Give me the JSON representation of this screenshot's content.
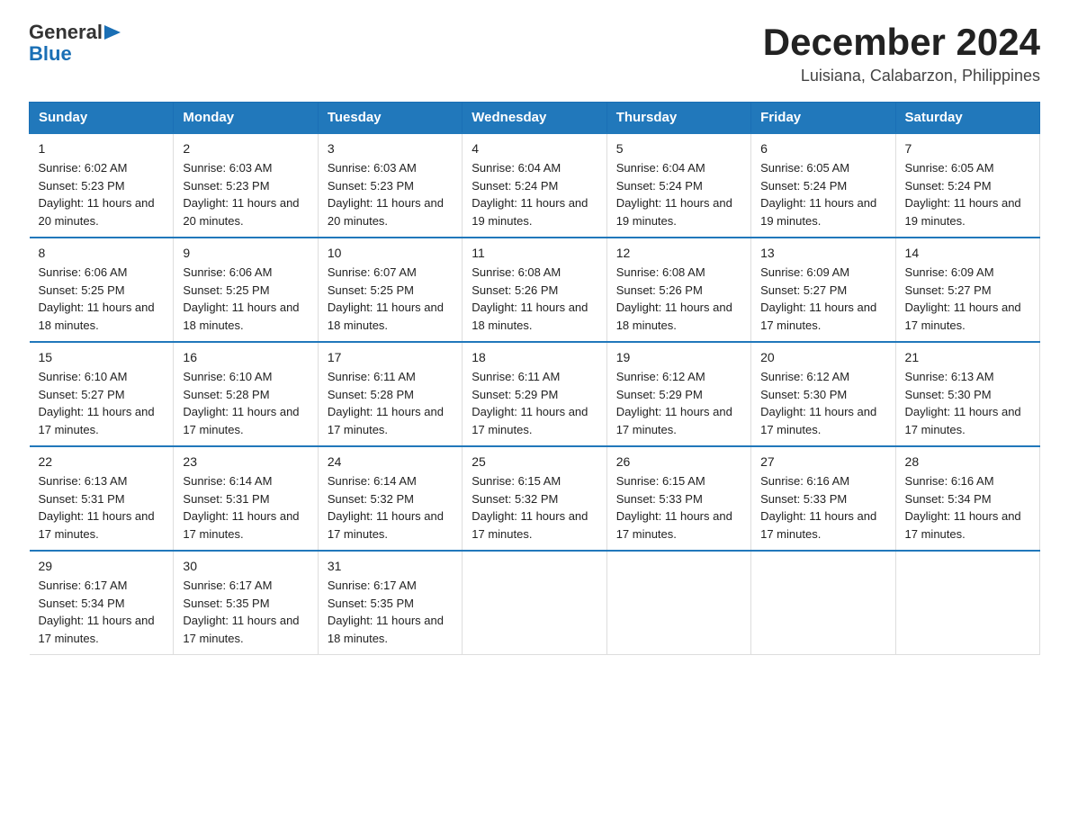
{
  "header": {
    "logo_general": "General",
    "logo_blue": "Blue",
    "main_title": "December 2024",
    "subtitle": "Luisiana, Calabarzon, Philippines"
  },
  "calendar": {
    "days_of_week": [
      "Sunday",
      "Monday",
      "Tuesday",
      "Wednesday",
      "Thursday",
      "Friday",
      "Saturday"
    ],
    "weeks": [
      [
        {
          "day": "1",
          "sunrise": "6:02 AM",
          "sunset": "5:23 PM",
          "daylight": "11 hours and 20 minutes."
        },
        {
          "day": "2",
          "sunrise": "6:03 AM",
          "sunset": "5:23 PM",
          "daylight": "11 hours and 20 minutes."
        },
        {
          "day": "3",
          "sunrise": "6:03 AM",
          "sunset": "5:23 PM",
          "daylight": "11 hours and 20 minutes."
        },
        {
          "day": "4",
          "sunrise": "6:04 AM",
          "sunset": "5:24 PM",
          "daylight": "11 hours and 19 minutes."
        },
        {
          "day": "5",
          "sunrise": "6:04 AM",
          "sunset": "5:24 PM",
          "daylight": "11 hours and 19 minutes."
        },
        {
          "day": "6",
          "sunrise": "6:05 AM",
          "sunset": "5:24 PM",
          "daylight": "11 hours and 19 minutes."
        },
        {
          "day": "7",
          "sunrise": "6:05 AM",
          "sunset": "5:24 PM",
          "daylight": "11 hours and 19 minutes."
        }
      ],
      [
        {
          "day": "8",
          "sunrise": "6:06 AM",
          "sunset": "5:25 PM",
          "daylight": "11 hours and 18 minutes."
        },
        {
          "day": "9",
          "sunrise": "6:06 AM",
          "sunset": "5:25 PM",
          "daylight": "11 hours and 18 minutes."
        },
        {
          "day": "10",
          "sunrise": "6:07 AM",
          "sunset": "5:25 PM",
          "daylight": "11 hours and 18 minutes."
        },
        {
          "day": "11",
          "sunrise": "6:08 AM",
          "sunset": "5:26 PM",
          "daylight": "11 hours and 18 minutes."
        },
        {
          "day": "12",
          "sunrise": "6:08 AM",
          "sunset": "5:26 PM",
          "daylight": "11 hours and 18 minutes."
        },
        {
          "day": "13",
          "sunrise": "6:09 AM",
          "sunset": "5:27 PM",
          "daylight": "11 hours and 17 minutes."
        },
        {
          "day": "14",
          "sunrise": "6:09 AM",
          "sunset": "5:27 PM",
          "daylight": "11 hours and 17 minutes."
        }
      ],
      [
        {
          "day": "15",
          "sunrise": "6:10 AM",
          "sunset": "5:27 PM",
          "daylight": "11 hours and 17 minutes."
        },
        {
          "day": "16",
          "sunrise": "6:10 AM",
          "sunset": "5:28 PM",
          "daylight": "11 hours and 17 minutes."
        },
        {
          "day": "17",
          "sunrise": "6:11 AM",
          "sunset": "5:28 PM",
          "daylight": "11 hours and 17 minutes."
        },
        {
          "day": "18",
          "sunrise": "6:11 AM",
          "sunset": "5:29 PM",
          "daylight": "11 hours and 17 minutes."
        },
        {
          "day": "19",
          "sunrise": "6:12 AM",
          "sunset": "5:29 PM",
          "daylight": "11 hours and 17 minutes."
        },
        {
          "day": "20",
          "sunrise": "6:12 AM",
          "sunset": "5:30 PM",
          "daylight": "11 hours and 17 minutes."
        },
        {
          "day": "21",
          "sunrise": "6:13 AM",
          "sunset": "5:30 PM",
          "daylight": "11 hours and 17 minutes."
        }
      ],
      [
        {
          "day": "22",
          "sunrise": "6:13 AM",
          "sunset": "5:31 PM",
          "daylight": "11 hours and 17 minutes."
        },
        {
          "day": "23",
          "sunrise": "6:14 AM",
          "sunset": "5:31 PM",
          "daylight": "11 hours and 17 minutes."
        },
        {
          "day": "24",
          "sunrise": "6:14 AM",
          "sunset": "5:32 PM",
          "daylight": "11 hours and 17 minutes."
        },
        {
          "day": "25",
          "sunrise": "6:15 AM",
          "sunset": "5:32 PM",
          "daylight": "11 hours and 17 minutes."
        },
        {
          "day": "26",
          "sunrise": "6:15 AM",
          "sunset": "5:33 PM",
          "daylight": "11 hours and 17 minutes."
        },
        {
          "day": "27",
          "sunrise": "6:16 AM",
          "sunset": "5:33 PM",
          "daylight": "11 hours and 17 minutes."
        },
        {
          "day": "28",
          "sunrise": "6:16 AM",
          "sunset": "5:34 PM",
          "daylight": "11 hours and 17 minutes."
        }
      ],
      [
        {
          "day": "29",
          "sunrise": "6:17 AM",
          "sunset": "5:34 PM",
          "daylight": "11 hours and 17 minutes."
        },
        {
          "day": "30",
          "sunrise": "6:17 AM",
          "sunset": "5:35 PM",
          "daylight": "11 hours and 17 minutes."
        },
        {
          "day": "31",
          "sunrise": "6:17 AM",
          "sunset": "5:35 PM",
          "daylight": "11 hours and 18 minutes."
        },
        null,
        null,
        null,
        null
      ]
    ]
  }
}
